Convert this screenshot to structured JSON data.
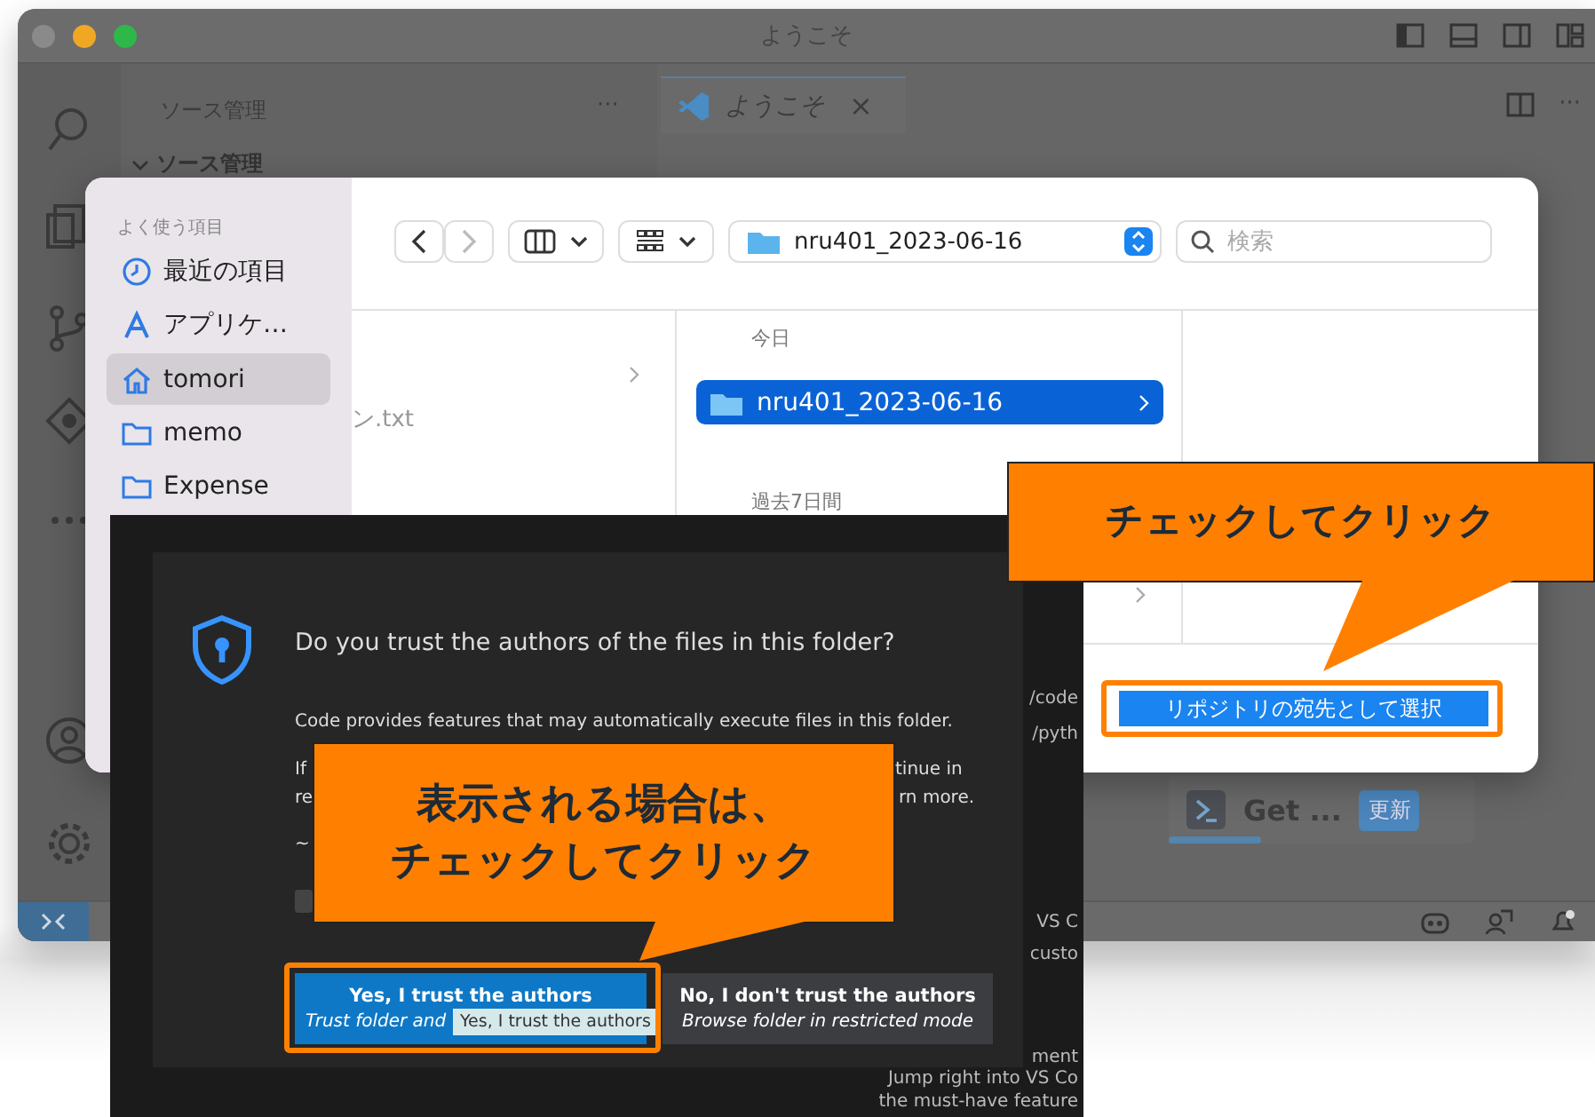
{
  "vscode": {
    "title": "ようこそ",
    "sidebar_title": "ソース管理",
    "sidebar_more": "···",
    "section": "ソース管理",
    "tab": {
      "label": "ようこそ",
      "close": "×",
      "selected": true
    },
    "editor_more": "···",
    "card": {
      "label": "Get ...",
      "badge": "更新",
      "level": 0.3
    }
  },
  "file_dialog": {
    "favorites_heading": "よく使う項目",
    "sidebar_items": [
      {
        "label": "最近の項目",
        "kind": "clock",
        "selected": false
      },
      {
        "label": "アプリケ…",
        "kind": "apps",
        "selected": false
      },
      {
        "label": "tomori",
        "kind": "home",
        "selected": true
      },
      {
        "label": "memo",
        "kind": "folder",
        "selected": false
      },
      {
        "label": "Expense",
        "kind": "folder",
        "selected": false
      }
    ],
    "location": "nru401_2023-06-16",
    "search": {
      "placeholder": "検索"
    },
    "partial_file": "ン.txt",
    "column_heading": "今日",
    "folder": {
      "label": "nru401_2023-06-16",
      "selected": true
    },
    "group_heading": "過去7日間",
    "confirm_button": "リポジトリの宛先として選択"
  },
  "trust_dialog": {
    "title": "Do you trust the authors of the files in this folder?",
    "body": "Code provides features that may automatically execute files in this folder.",
    "partial_left": [
      "If",
      "re",
      "~"
    ],
    "partial_right": [
      "tinue in",
      "rn more."
    ],
    "checkbox": {
      "checked": false
    },
    "buttons": [
      {
        "label": "Yes, I trust the authors",
        "sub": "Trust folder and",
        "kind": "primary"
      },
      {
        "label": "No, I don't trust the authors",
        "sub": "Browse folder in restricted mode",
        "kind": "secondary"
      }
    ],
    "tooltip": "Yes, I trust the authors"
  },
  "background_texts": [
    "/code",
    "/pyth",
    "VS C",
    "custo",
    "ment",
    "Jump right into VS Co",
    "the must-have feature"
  ],
  "callouts": [
    {
      "lines": [
        "チェックしてクリック"
      ]
    },
    {
      "lines": [
        "表示される場合は、",
        "チェックしてクリック"
      ]
    }
  ]
}
